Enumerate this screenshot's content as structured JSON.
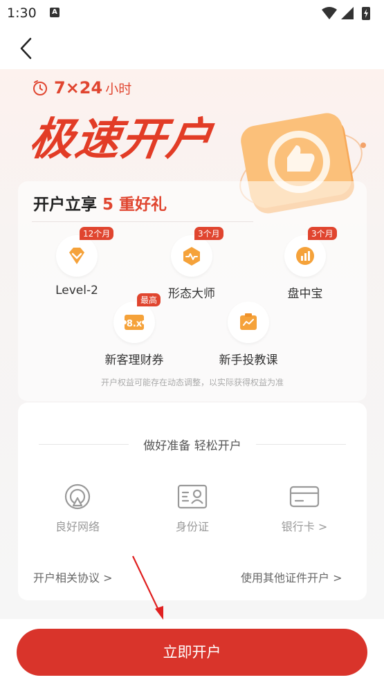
{
  "status_bar": {
    "time": "1:30",
    "a_badge": "A"
  },
  "hero": {
    "hours_big": "7×24",
    "hours_small": "小时",
    "title": "极速开户"
  },
  "benefits": {
    "title_prefix": "开户立享",
    "title_num": "5",
    "title_suffix": "重好礼",
    "items": [
      {
        "label": "Level-2",
        "badge": "12个月",
        "icon": "level2-diamond-icon"
      },
      {
        "label": "形态大师",
        "badge": "3个月",
        "icon": "pattern-hexagon-icon"
      },
      {
        "label": "盘中宝",
        "badge": "3个月",
        "icon": "chart-bars-icon"
      },
      {
        "label": "新客理财券",
        "badge": "最高",
        "icon": "coupon-icon",
        "coupon_text": "8.x"
      },
      {
        "label": "新手投教课",
        "badge": "",
        "icon": "course-chart-icon"
      }
    ],
    "note": "开户权益可能存在动态调整，以实际获得权益为准"
  },
  "prep": {
    "title": "做好准备 轻松开户",
    "items": [
      {
        "label": "良好网络",
        "icon": "network-icon"
      },
      {
        "label": "身份证",
        "icon": "id-card-icon"
      },
      {
        "label": "银行卡 >",
        "icon": "bank-card-icon"
      }
    ],
    "agreement_link": "开户相关协议 >",
    "other_id_link": "使用其他证件开户 >"
  },
  "cta": {
    "label": "立即开户"
  },
  "colors": {
    "brand_red": "#d9342b",
    "accent_orange": "#f5a23a"
  }
}
